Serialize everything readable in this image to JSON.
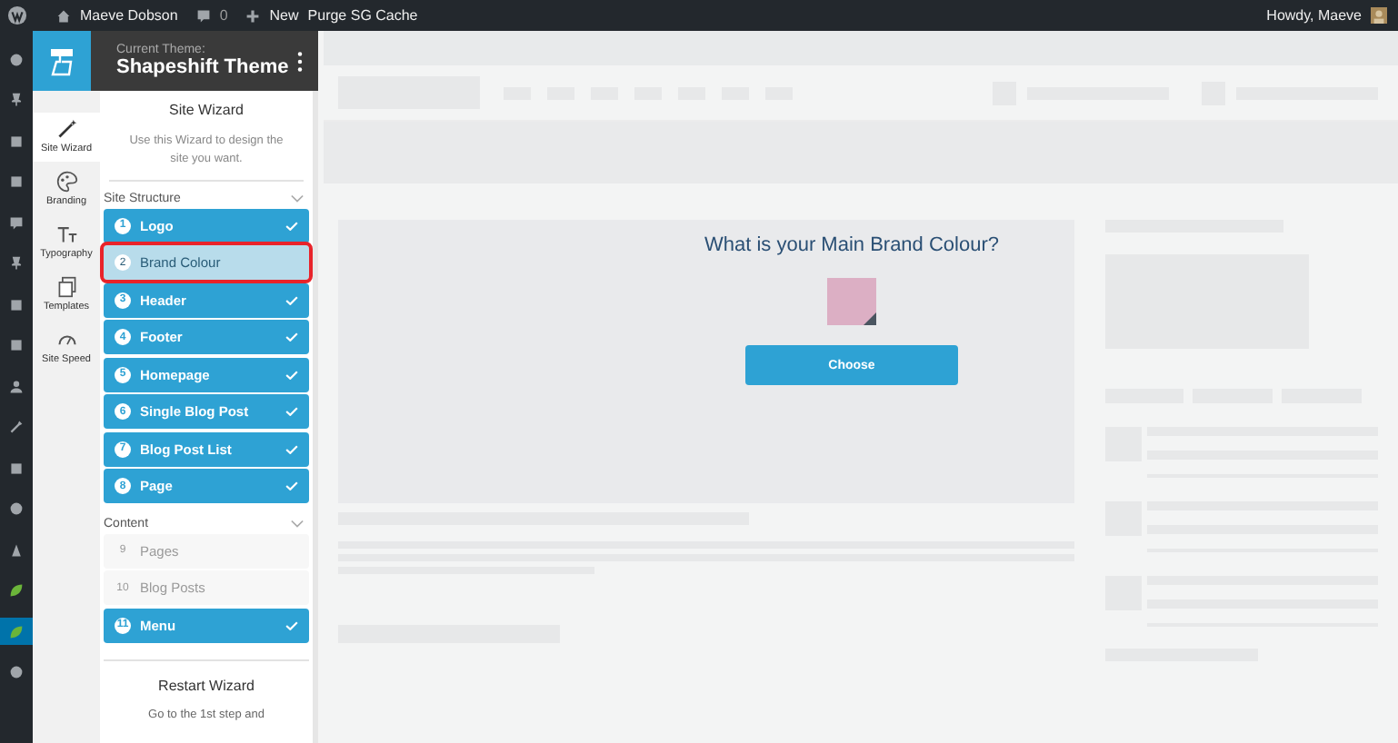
{
  "admin_bar": {
    "site": "Maeve Dobson",
    "comments": "0",
    "new": "New",
    "purge": "Purge SG Cache",
    "greeting": "Howdy, Maeve"
  },
  "theme_header": {
    "caption": "Current Theme:",
    "title": "Shapeshift Theme"
  },
  "side_tabs": [
    {
      "label": "Site Wizard",
      "selected": true
    },
    {
      "label": "Branding",
      "selected": false
    },
    {
      "label": "Typography",
      "selected": false
    },
    {
      "label": "Templates",
      "selected": false
    },
    {
      "label": "Site Speed",
      "selected": false
    }
  ],
  "panel": {
    "title": "Site Wizard",
    "description": "Use this Wizard to design the site you want.",
    "sections": [
      {
        "title": "Site Structure",
        "expanded": true,
        "steps": [
          {
            "number": "1",
            "label": "Logo",
            "completed": true,
            "selected": false,
            "disabled": false,
            "highlighted": false
          },
          {
            "number": "2",
            "label": "Brand Colour",
            "completed": false,
            "selected": true,
            "disabled": false,
            "highlighted": true
          },
          {
            "number": "3",
            "label": "Header",
            "completed": true,
            "selected": false,
            "disabled": false,
            "highlighted": false
          },
          {
            "number": "4",
            "label": "Footer",
            "completed": true,
            "selected": false,
            "disabled": false,
            "highlighted": false
          },
          {
            "number": "5",
            "label": "Homepage",
            "completed": true,
            "selected": false,
            "disabled": false,
            "highlighted": false
          },
          {
            "number": "6",
            "label": "Single Blog Post",
            "completed": true,
            "selected": false,
            "disabled": false,
            "highlighted": false
          },
          {
            "number": "7",
            "label": "Blog Post List",
            "completed": true,
            "selected": false,
            "disabled": false,
            "highlighted": false
          },
          {
            "number": "8",
            "label": "Page",
            "completed": true,
            "selected": false,
            "disabled": false,
            "highlighted": false
          }
        ]
      },
      {
        "title": "Content",
        "expanded": true,
        "steps": [
          {
            "number": "9",
            "label": "Pages",
            "completed": false,
            "selected": false,
            "disabled": true,
            "highlighted": false
          },
          {
            "number": "10",
            "label": "Blog Posts",
            "completed": false,
            "selected": false,
            "disabled": true,
            "highlighted": false
          },
          {
            "number": "11",
            "label": "Menu",
            "completed": true,
            "selected": false,
            "disabled": false,
            "highlighted": false
          }
        ]
      }
    ],
    "restart": {
      "title": "Restart Wizard",
      "text": "Go to the 1st step and"
    }
  },
  "preview": {
    "question": "What is your Main Brand Colour?",
    "swatch": {
      "color": "#dcafc4"
    },
    "button": "Choose"
  }
}
